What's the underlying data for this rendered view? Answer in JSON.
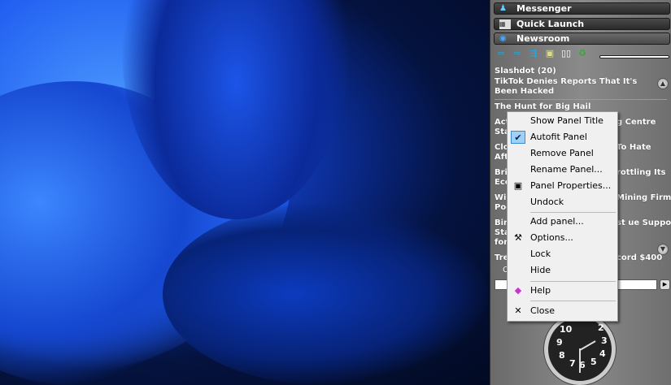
{
  "sidebar": {
    "panels": [
      {
        "title": "Messenger",
        "icon": "messenger-icon"
      },
      {
        "title": "Quick Launch",
        "icon": "quick-launch-icon"
      },
      {
        "title": "Newsroom",
        "icon": "globe-icon"
      }
    ],
    "toolbar": [
      "back-arrow-icon",
      "forward-arrow-icon",
      "refresh-feed-icon",
      "properties-icon",
      "book-icon",
      "recycle-icon"
    ],
    "feed_title": "Slashdot (20)",
    "headlines": [
      {
        "left": "TikTok Denies Reports That It's Been Hacked"
      },
      {
        "left": "The Hunt for Big Hail"
      },
      {
        "left": "Act\nSta",
        "right": "g Centre"
      },
      {
        "left": "Clo\nAft",
        "right": "To Hate"
      },
      {
        "left": "Bri\nEco",
        "right": "rottling Its"
      },
      {
        "left": "Wi\nPoo",
        "right": "Mining Firm\ns'"
      },
      {
        "left": "Bin\nSta\nfor",
        "right": "st\nue Support"
      },
      {
        "left": "Tre",
        "right": "cord $400"
      }
    ],
    "footer_text": "C",
    "clock_numbers": [
      "10",
      "9",
      "8",
      "7",
      "6",
      "5",
      "4",
      "3",
      "2"
    ]
  },
  "menu": {
    "items": [
      "Show Panel Title",
      "Autofit Panel",
      "Remove Panel",
      "Rename Panel...",
      "Panel Properties...",
      "Undock",
      "Add panel...",
      "Options...",
      "Lock",
      "Hide",
      "Help",
      "Close"
    ]
  }
}
